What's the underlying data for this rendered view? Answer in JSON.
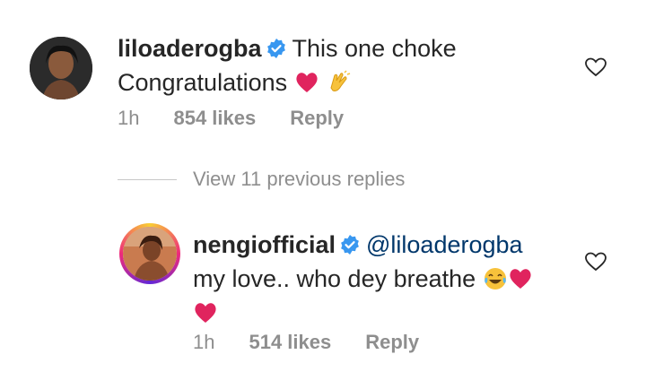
{
  "comments": [
    {
      "username": "liloaderogba",
      "text_line1": "This one choke",
      "text_line2": "Congratulations",
      "time": "1h",
      "likes": "854 likes",
      "reply_label": "Reply",
      "emojis": [
        "red-heart",
        "clapping-hands"
      ]
    },
    {
      "username": "nengiofficial",
      "mention": "@liloaderogba",
      "text_line1": "my love.. who dey breathe",
      "time": "1h",
      "likes": "514 likes",
      "reply_label": "Reply",
      "emojis": [
        "tears-of-joy",
        "red-heart",
        "red-heart"
      ]
    }
  ],
  "thread": {
    "view_replies_label": "View 11 previous replies"
  },
  "colors": {
    "verified": "#3897f0",
    "heart_emoji": "#e0245e",
    "muted": "#8e8e8e",
    "mention": "#00376b"
  }
}
